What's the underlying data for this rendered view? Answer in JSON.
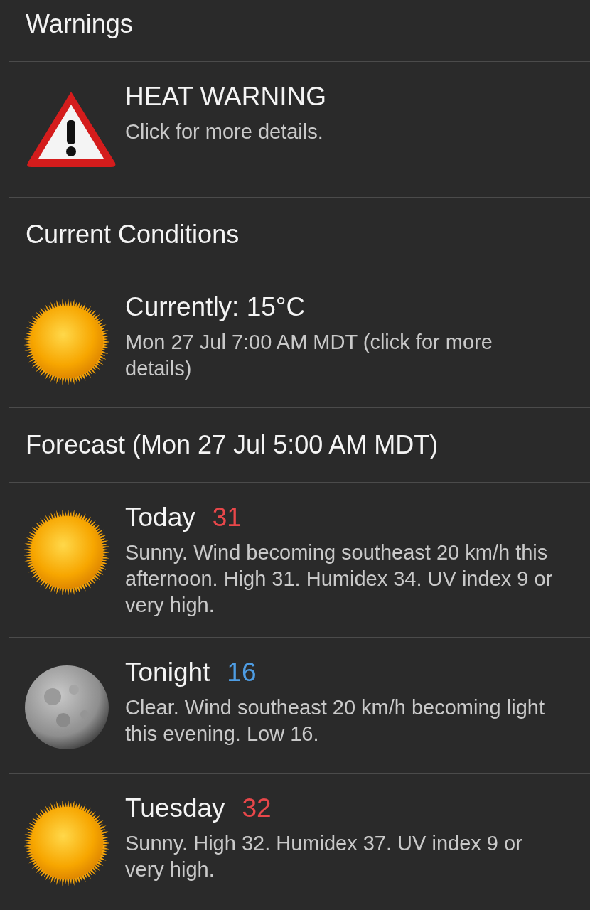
{
  "sections": [
    {
      "header": "Warnings",
      "items": [
        {
          "kind": "warning",
          "title": "HEAT WARNING",
          "description": "Click for more details."
        }
      ]
    },
    {
      "header": "Current Conditions",
      "items": [
        {
          "kind": "sun",
          "title": "Currently: 15°C",
          "description": "Mon 27 Jul 7:00 AM MDT (click for more details)"
        }
      ]
    },
    {
      "header": "Forecast (Mon 27 Jul 5:00 AM MDT)",
      "items": [
        {
          "kind": "sun",
          "title": "Today",
          "temperature": {
            "text": "31",
            "kind": "high"
          },
          "description": "Sunny. Wind becoming southeast 20 km/h this afternoon. High 31. Humidex 34. UV index 9 or very high."
        },
        {
          "kind": "moon",
          "title": "Tonight",
          "temperature": {
            "text": "16",
            "kind": "low"
          },
          "description": "Clear. Wind southeast 20 km/h becoming light this evening. Low 16."
        },
        {
          "kind": "sun",
          "title": "Tuesday",
          "temperature": {
            "text": "32",
            "kind": "high"
          },
          "description": "Sunny. High 32. Humidex 37. UV index 9 or very high."
        }
      ]
    }
  ]
}
